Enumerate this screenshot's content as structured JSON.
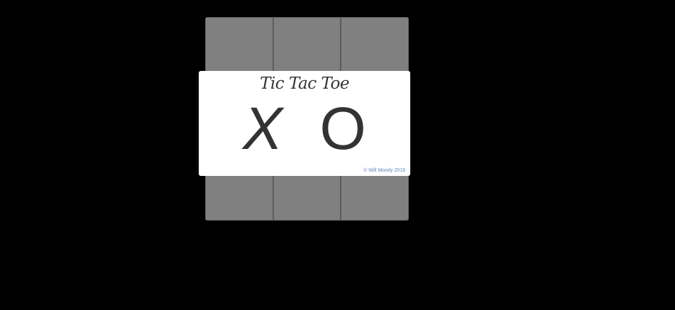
{
  "game": {
    "board": {
      "cells": [
        "",
        "",
        "",
        "",
        "",
        "",
        "",
        "",
        ""
      ]
    },
    "modal": {
      "title": "Tic Tac Toe",
      "choices": [
        "X",
        "O"
      ],
      "credit": "© Will Moody 2016"
    }
  }
}
